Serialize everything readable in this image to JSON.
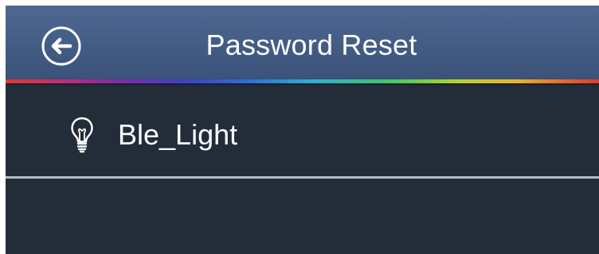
{
  "header": {
    "title": "Password Reset",
    "back_icon": "back-arrow-circle-icon"
  },
  "device_list": [
    {
      "name": "Ble_Light",
      "icon": "lightbulb-icon"
    }
  ],
  "colors": {
    "header_background": "#435c84",
    "screen_background": "#232c39",
    "text": "#ffffff",
    "divider": "#b8bcc2",
    "accent_bar": "rainbow-gradient"
  }
}
